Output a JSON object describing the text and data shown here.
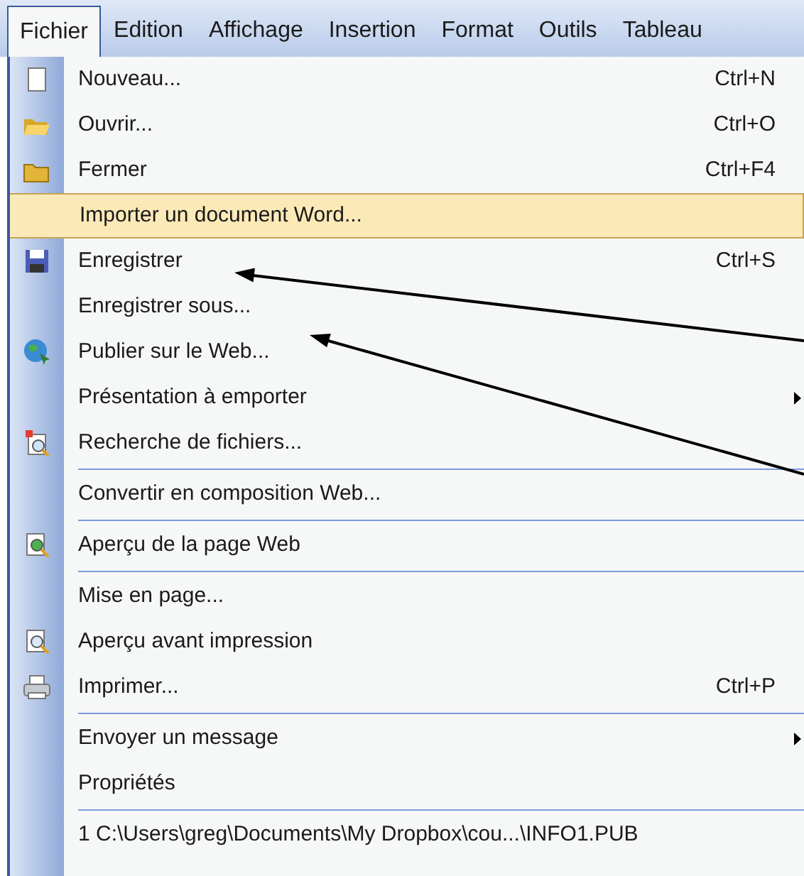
{
  "menu_bar": [
    {
      "label": "Fichier",
      "selected": true
    },
    {
      "label": "Edition",
      "selected": false
    },
    {
      "label": "Affichage",
      "selected": false
    },
    {
      "label": "Insertion",
      "selected": false
    },
    {
      "label": "Format",
      "selected": false
    },
    {
      "label": "Outils",
      "selected": false
    },
    {
      "label": "Tableau",
      "selected": false
    }
  ],
  "menu": {
    "items": [
      {
        "label": "Nouveau...",
        "shortcut": "Ctrl+N",
        "selected": false
      },
      {
        "label": "Ouvrir...",
        "shortcut": "Ctrl+O",
        "selected": false
      },
      {
        "label": "Fermer",
        "shortcut": "Ctrl+F4",
        "selected": false
      },
      {
        "label": "Importer un document Word...",
        "selected": true
      },
      {
        "label": "Enregistrer",
        "shortcut": "Ctrl+S",
        "selected": false
      },
      {
        "label": "Enregistrer sous...",
        "selected": false
      },
      {
        "label": "Publier sur le Web...",
        "selected": false
      },
      {
        "label": "Présentation à emporter",
        "submenu": true,
        "selected": false
      },
      {
        "label": "Recherche de fichiers...",
        "selected": false,
        "separator_after": true
      },
      {
        "label": "Convertir en composition Web...",
        "selected": false,
        "separator_after": true
      },
      {
        "label": "Aperçu de la page Web",
        "selected": false,
        "separator_after": true
      },
      {
        "label": "Mise en page...",
        "selected": false
      },
      {
        "label": "Aperçu avant impression",
        "selected": false
      },
      {
        "label": "Imprimer...",
        "shortcut": "Ctrl+P",
        "selected": false,
        "separator_after": true
      },
      {
        "label": "Envoyer un message",
        "submenu": true,
        "selected": false
      },
      {
        "label": "Propriétés",
        "selected": false,
        "separator_after": true
      },
      {
        "label": "1 C:\\Users\\greg\\Documents\\My Dropbox\\cou...\\INFO1.PUB",
        "selected": false
      }
    ]
  }
}
